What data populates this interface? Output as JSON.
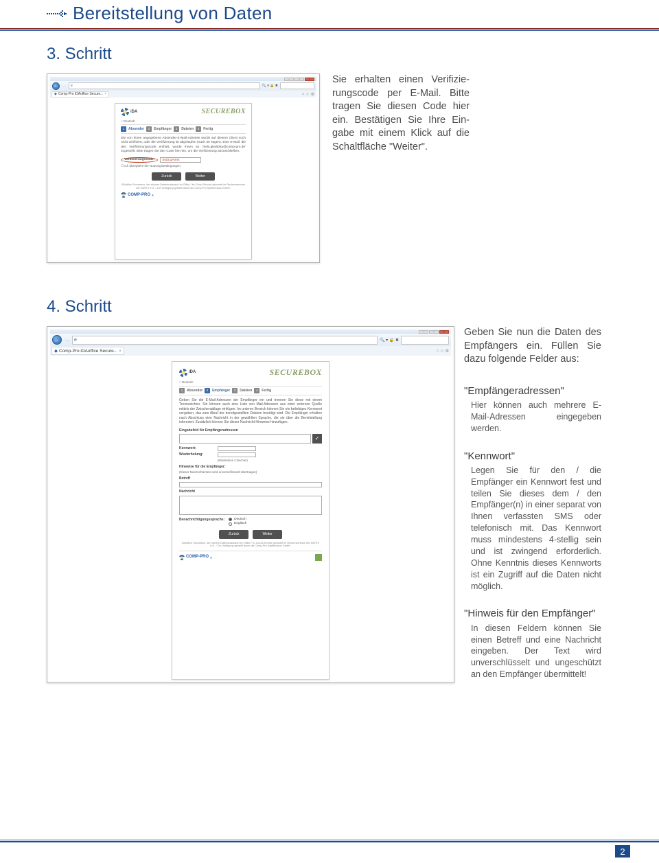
{
  "header": {
    "title": "Bereitstellung von Daten"
  },
  "step3": {
    "title": "3. Schritt",
    "text": "Sie erhalten einen Verifizie­rungscode per E-Mail. Bitte tragen Sie diesen Code hier ein. Bestätigen Sie Ihre Ein­gabe mit einem Klick auf die Schaltfläche \"Weiter\".",
    "browser": {
      "tab": "Comp-Pro iDAoffice Secure...",
      "searchHint": "🔍 ▾ 🔒 ✖",
      "securebox": "SECUREBOX",
      "wizard": {
        "n1": "1",
        "l1": "Absender",
        "n2": "2",
        "l2": "Empfänger",
        "n3": "3",
        "l3": "Dateien",
        "n4": "4",
        "l4": "Fertig"
      },
      "para": "Die von Ihnen angegebene Absender-E-Mail-Adresse wurde auf diesem Client noch nicht verifiziert, oder die Verifizierung ist abgelaufen (nach 30 Tagen). Eine E-Mail, die den Verifizierungscode enthält, wurde Ihnen an 'niels.gleditzky@comp-pro.de' zugestellt. Bitte tragen Sie den Code hier ein, um die Verifizierung abzuschließen.",
      "verifyLabel": "Verifizierungscode:",
      "verifyValue": "SsDCqAXmt",
      "terms": "Ich akzeptiere die Nutzungsbedingungen.",
      "btnBack": "Zurück",
      "btnNext": "Weiter",
      "foot": "iDAoffice Securebox, der sichere Datenaustausch im Office / im Cloud-Service gehostet im Rechenzentrum der DATEV e.G. / Zur Verfügung gestellt durch die Comp-Pro Systemhaus GmbH.",
      "brand": "COMP-PRO"
    }
  },
  "step4": {
    "title": "4. Schritt",
    "intro": "Geben Sie nun die Daten des Empfängers ein. Füllen Sie dazu folgende Felder aus:",
    "sec1h": "\"Empfängeradressen\"",
    "sec1p": "Hier können auch mehrere E-Mail-Adressen eingegeben werden.",
    "sec2h": "\"Kennwort\"",
    "sec2p": "Legen Sie für den / die Empfänger ein Kennwort fest und teilen Sie dieses dem / den Empfänger(n) in einer separat von Ihnen verfassten SMS oder telefonisch mit. Das Kennwort muss mindestens 4-stellig sein und ist zwingend erforderlich. Ohne Kenntnis dieses Kennworts ist ein Zugriff auf die Daten nicht möglich.",
    "sec3h": "\"Hinweis für den Empfänger\"",
    "sec3p": "In diesen Feldern können Sie einen Betreff und eine Nachricht einge­ben. Der Text wird unverschlüsselt und ungeschützt an den Empfänger übermittelt!",
    "browser": {
      "tab": "Comp-Pro iDAoffice Secure...",
      "securebox": "SECUREBOX",
      "lang": "Deutsch",
      "wizard": {
        "n1": "1",
        "l1": "Absender",
        "n2": "2",
        "l2": "Empfänger",
        "n3": "3",
        "l3": "Dateien",
        "n4": "4",
        "l4": "Fertig"
      },
      "para": "Geben Sie die E-Mail-Adressen der Empfänger ein und trennen Sie diese mit einem Trennzeichen. Sie können auch eine Liste von Mail-Adressen aus einer externen Quelle mittels der Zwischenablage einfügen. Im unteren Bereich können Sie ein beliebiges Kennwort vergeben, das zum Abruf der bereitgestellten Dateien benötigt wird. Die Empfänger erhalten nach Abschluss eine Nachricht in der gewählten Sprache, die sie über die Bereitstellung informiert. Zusätzlich können Sie dieser Nachricht Hinweise hinzufügen.",
      "empLabel": "Eingabefeld für Empfängeradressen",
      "pwLabel": "Kennwort:",
      "pw2Label": "Wiederholung:",
      "pwHint": "(Mindestens 4 Zeichen)",
      "hinH": "Hinweise für die Empfänger:",
      "hinSub": "(Dieser Nachrichtentext wird unverschlüsselt übertragen)",
      "betreff": "Betreff",
      "nachricht": "Nachricht",
      "notifLabel": "Benachrichtigungssprache:",
      "optDe": "Deutsch",
      "optEn": "Englisch",
      "btnBack": "Zurück",
      "btnNext": "Weiter",
      "foot": "iDAoffice Securebox, der sichere Datenaustausch im Office / im Cloud-Service gehostet im Rechenzentrum der DATEV e.G. / Zur Verfügung gestellt durch die Comp-Pro Systemhaus GmbH.",
      "brand": "COMP-PRO"
    }
  },
  "pageNumber": "2"
}
